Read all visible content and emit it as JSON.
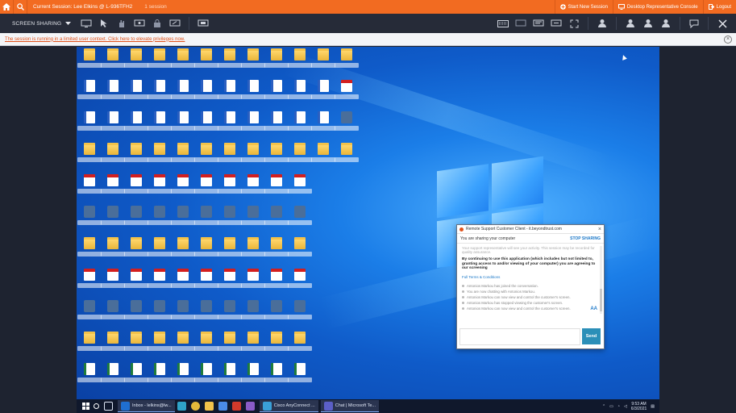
{
  "topbar": {
    "session_text": "Current Session: Lee Elkins @ L-936TFH2",
    "session_count": "1 session",
    "start_new": "Start New Session",
    "rep_console": "Desktop Representative Console",
    "logout": "Logout"
  },
  "toolbar": {
    "screen_sharing": "SCREEN SHARING"
  },
  "infobar": {
    "message": "The session is running in a limited user context. Click here to elevate privileges now."
  },
  "taskbar": {
    "apps": [
      "Inbox - lelkins@lw...",
      "Cisco AnyConnect ...",
      "Chat | Microsoft Te..."
    ],
    "time": "9:53 AM",
    "date": "6/3/2021"
  },
  "dialog": {
    "title": "Remote Support Customer Client - it.beyondtrust.com",
    "sharing_status": "You are sharing your computer",
    "stop_sharing": "STOP SHARING",
    "faint_text": "Your support representative will see your activity. This session may be recorded for quality assurance.",
    "consent": "By continuing to use this application (which includes but not limited to, granting access to and/or viewing of your computer) you are agreeing to our screening",
    "terms_link": "Full Terms & Conditions",
    "events": [
      "Antonios Markou has joined the conversation.",
      "You are now chatting with Antonios Markou.",
      "Antonios Markou can now view and control the customer's screen.",
      "Antonios Markou has stopped viewing the customer's screen.",
      "Antonios Markou can now view and control the customer's screen."
    ],
    "font_size_label": "AA",
    "send_label": "Send"
  }
}
